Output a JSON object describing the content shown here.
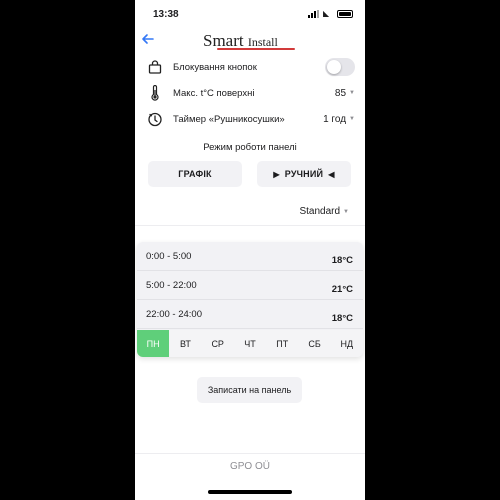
{
  "status_bar": {
    "time": "13:38"
  },
  "header": {
    "logo_main": "Smart ",
    "logo_sub": "Install"
  },
  "settings": [
    {
      "label": "Блокування кнопок",
      "type": "toggle",
      "on": false
    },
    {
      "label": "Макс. t°C поверхні",
      "value": "85"
    },
    {
      "label": "Таймер «Рушникосушки»",
      "value": "1 год"
    }
  ],
  "mode": {
    "title": "Режим роботи панелі",
    "schedule_label": "ГРАФІК",
    "manual_label": "РУЧНИЙ"
  },
  "preset": {
    "value": "Standard"
  },
  "schedule": {
    "rows": [
      {
        "time": "0:00 - 5:00",
        "temp": "18°C"
      },
      {
        "time": "5:00 - 22:00",
        "temp": "21°C"
      },
      {
        "time": "22:00 - 24:00",
        "temp": "18°C"
      }
    ],
    "days": [
      "ПН",
      "ВТ",
      "СР",
      "ЧТ",
      "ПТ",
      "СБ",
      "НД"
    ],
    "active_day": "ПН"
  },
  "write_button": "Записати на панель",
  "footer": "GPO OÜ",
  "colors": {
    "accent": "#3478f6",
    "active_day": "#5fcf7a",
    "logo_underline": "#d23a3a"
  }
}
